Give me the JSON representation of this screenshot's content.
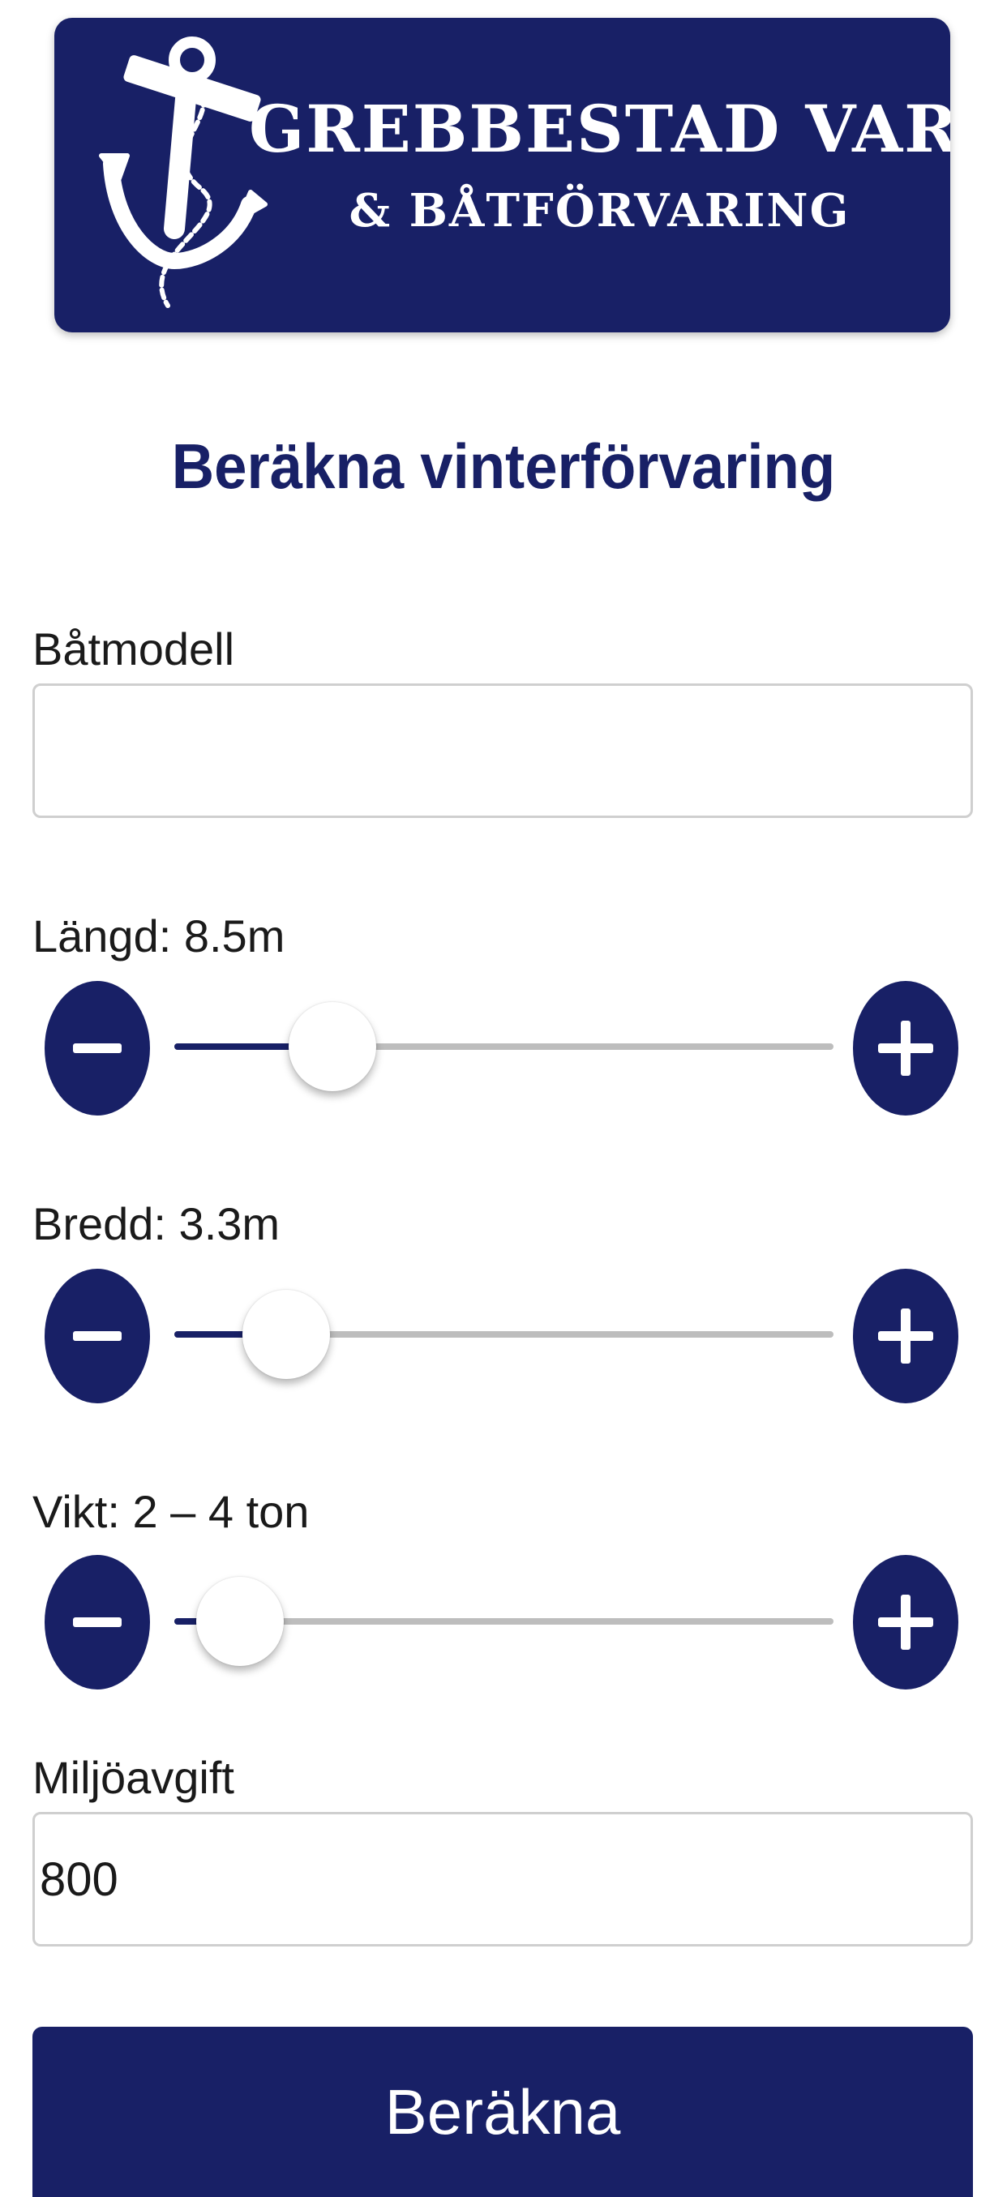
{
  "banner": {
    "line1": "Grebbestad Varv",
    "line2": "& Båtförvaring",
    "logo_icon": "anchor-icon",
    "color": "#182066"
  },
  "title": "Beräkna vinterförvaring",
  "form": {
    "boat_model": {
      "label": "Båtmodell",
      "value": ""
    },
    "length": {
      "label": "Längd: 8.5m",
      "level": 0.24
    },
    "width": {
      "label": "Bredd: 3.3m",
      "level": 0.17
    },
    "weight": {
      "label": "Vikt: 2 – 4 ton",
      "level": 0.1
    },
    "env_fee": {
      "label": "Miljöavgift",
      "value": "800"
    },
    "minus_icon": "minus-icon",
    "plus_icon": "plus-icon"
  },
  "calculate_button": {
    "label": "Beräkna"
  },
  "colors": {
    "accent": "#182066",
    "track": "#bdbdbd",
    "field_border": "#cfcfcf"
  }
}
